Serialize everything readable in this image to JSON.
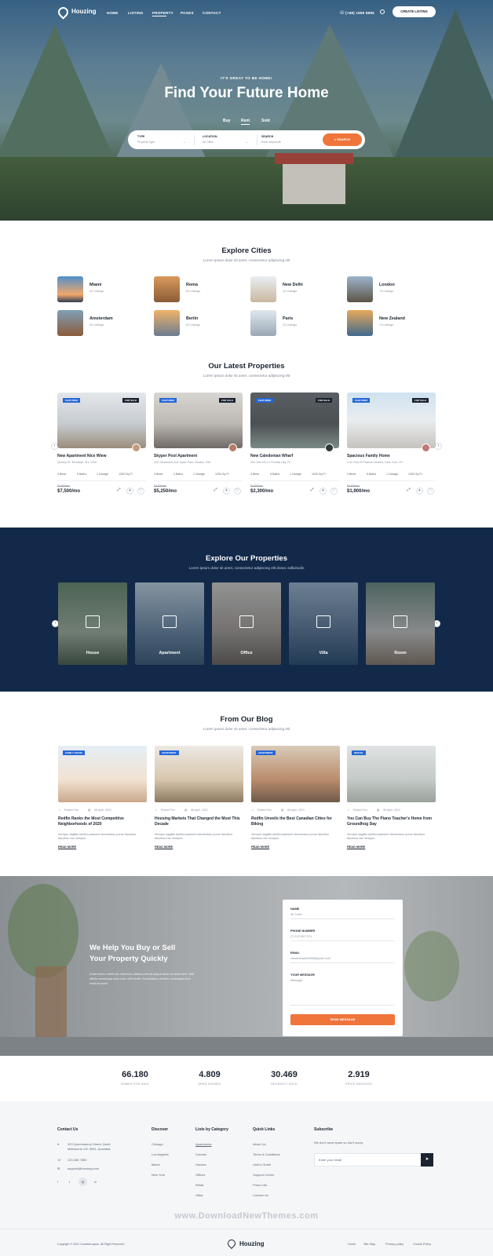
{
  "nav": {
    "brand": "Houzing",
    "items": [
      "HOME",
      "LISTING",
      "PROPERTY",
      "PAGES",
      "CONTACT"
    ],
    "phone": "(+68) 1999 8885",
    "cta": "CREATE LISTING"
  },
  "hero": {
    "kicker": "IT'S GREAT TO BE HOME!",
    "title": "Find Your Future Home",
    "tabs": [
      "Buy",
      "Rent",
      "Sold"
    ],
    "search": {
      "type_label": "TYPE",
      "type_value": "Property Type",
      "location_label": "LOCATION",
      "location_value": "All Cities",
      "search_label": "SEARCH",
      "search_placeholder": "Enter keywords",
      "button": "SEARCH"
    }
  },
  "cities": {
    "title": "Explore Cities",
    "subtitle": "Lorem ipsum dolor sit amet, consectetur adipiscing elit",
    "items": [
      {
        "name": "Miami",
        "count": "42 Listings"
      },
      {
        "name": "Roma",
        "count": "92 Listings"
      },
      {
        "name": "New Delhi",
        "count": "12 Listings"
      },
      {
        "name": "London",
        "count": "74 Listings"
      },
      {
        "name": "Amsterdam",
        "count": "42 Listings"
      },
      {
        "name": "Berlin",
        "count": "92 Listings"
      },
      {
        "name": "Paris",
        "count": "12 Listings"
      },
      {
        "name": "New Zealand",
        "count": "74 Listings"
      }
    ]
  },
  "latest": {
    "title": "Our Latest Properties",
    "subtitle": "Lorem ipsum dolor sit amet, consectetur adipiscing elit",
    "tag_featured": "FEATURED",
    "tag_sale": "FOR SALE",
    "items": [
      {
        "title": "New Apartment Nice Wiew",
        "address": "Quincy St, Brooklyn, NY, USA",
        "beds": "4 Beds",
        "baths": "5 Baths",
        "garage": "1 Garage",
        "area": "1200 Sq Ft",
        "old_price": "$2,800/mo",
        "price": "$7,500/mo"
      },
      {
        "title": "Skyper Pool Apartment",
        "address": "112 Glenwood Ave Hyde Park, Boston, MA",
        "beds": "4 Beds",
        "baths": "2 Baths",
        "garage": "1 Garage",
        "area": "1200 Sq Ft",
        "old_price": "$2,800/mo",
        "price": "$5,250/mo"
      },
      {
        "title": "New Caledonian Wharf",
        "address": "251 SW 4th Ln Florida City, FL",
        "beds": "4 Beds",
        "baths": "5 Baths",
        "garage": "1 Garage",
        "area": "1200 Sq Ft",
        "old_price": "$2,800/mo",
        "price": "$2,300/mo"
      },
      {
        "title": "Spacious Family Home",
        "address": "4 W 21st St Flatiron District, New York, NY",
        "beds": "4 Beds",
        "baths": "5 Baths",
        "garage": "1 Garage",
        "area": "1200 Sq Ft",
        "old_price": "$2,800/mo",
        "price": "$1,900/mo"
      }
    ]
  },
  "explore": {
    "title": "Explore Our Properties",
    "subtitle": "Lorem ipsum dolor sit amet, consectetur adipiscing elit donec sollicitudin",
    "items": [
      "House",
      "Apartment",
      "Office",
      "Villa",
      "Room"
    ]
  },
  "blog": {
    "title": "From Our Blog",
    "subtitle": "Lorem ipsum dolor sit amet, consectetur adipiscing elit",
    "read_more": "READ MORE",
    "items": [
      {
        "tag": "FAMILY HOUSE",
        "author": "Robert Fox",
        "date": "06 April, 2021",
        "title": "Redfin Ranks the Most Competitive Neighborhoods of 2020",
        "excerpt": "Semper sagittis facilisi praesent elementum purus faucibus faucibus non tempus."
      },
      {
        "tag": "APARTMENT",
        "author": "Robert Fox",
        "date": "06 April, 2021",
        "title": "Housing Markets That Changed the Most This Decade",
        "excerpt": "Semper sagittis facilisi praesent elementum purus faucibus faucibus non tempus."
      },
      {
        "tag": "APARTMENT",
        "author": "Robert Fox",
        "date": "06 April, 2021",
        "title": "Redfin Unveils the Best Canadian Cities for Biking",
        "excerpt": "Semper sagittis facilisi praesent elementum purus faucibus faucibus non tempus."
      },
      {
        "tag": "RENTAL",
        "author": "Robert Fox",
        "date": "06 April, 2021",
        "title": "You Can Buy The Piano Teacher's Home from Groundhog Day",
        "excerpt": "Semper sagittis facilisi praesent elementum purus faucibus faucibus non tempus."
      }
    ]
  },
  "contact": {
    "title": "We Help You Buy or Sell Your Property Quickly",
    "text": "Amet minim mollit non deserunt ullamco est sit aliqua dolor do amet sint. Velit officia consequat duis enim velit mollit. Exercitation veniam consequat sunt nostrud amet.",
    "name_label": "NAME",
    "name_value": "Ali Tufan",
    "phone_label": "PHONE NUMBER",
    "phone_value": "(7) 123 567 974",
    "email_label": "EMAIL",
    "email_value": "creativelayers088@gmail.com",
    "message_label": "YOUR MESSAGE",
    "message_value": "Message",
    "button": "SEND MESSAGE"
  },
  "stats": [
    {
      "value": "66.180",
      "label": "HOMES FOR SALE"
    },
    {
      "value": "4.809",
      "label": "OPEN HOUSES"
    },
    {
      "value": "30.469",
      "label": "RECENTLY SOLD"
    },
    {
      "value": "2.919",
      "label": "PRICE REDUCED"
    }
  ],
  "footer": {
    "contact_title": "Contact Us",
    "address": "329 Queensberry Street, North Melbourne VIC 3051, Australia.",
    "phone": "123 456 7890",
    "email": "support@houzing.com",
    "discover_title": "Discover",
    "discover": [
      "Chicago",
      "Los Angeles",
      "Miami",
      "New York"
    ],
    "category_title": "Lists by Category",
    "categories": [
      "Apartments",
      "Condos",
      "Houses",
      "Offices",
      "Retail",
      "Villas"
    ],
    "quick_title": "Quick Links",
    "quick": [
      "About Us",
      "Terms & Conditions",
      "User's Guide",
      "Support Center",
      "Press Info",
      "Contact Us"
    ],
    "subscribe_title": "Subscribe",
    "subscribe_text": "We don't send spam so don't worry.",
    "email_placeholder": "Enter your email",
    "watermark": "www.DownloadNewThemes.com",
    "copyright": "Copyright © 2021 CreativeLayers. All Right Reserved.",
    "brand": "Houzing",
    "bottom_links": [
      "Home",
      "Site Map",
      "Privacy policy",
      "Cookie Policy"
    ]
  }
}
